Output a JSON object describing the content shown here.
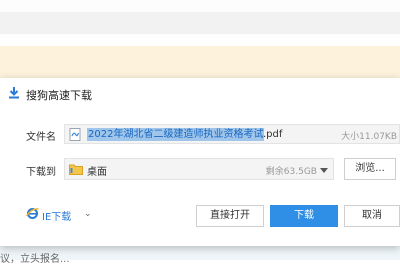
{
  "background": {
    "bottom_text": "议，立头报名..."
  },
  "dialog": {
    "title": "搜狗高速下载",
    "filename_label": "文件名",
    "filename_selected": "2022年湖北省二级建造师执业资格考试",
    "filename_ext": ".pdf",
    "file_size": "大小11.07KB",
    "download_to_label": "下载到",
    "destination": "桌面",
    "free_space": "剩余63.5GB",
    "browse_label": "浏览...",
    "ie_download_label": "IE下载",
    "open_direct_label": "直接打开",
    "download_label": "下载",
    "cancel_label": "取消"
  },
  "colors": {
    "accent": "#2f8fe6",
    "selection": "#9fc6ea",
    "yellow_bar": "#fdf3dd"
  },
  "icons": {
    "title": "download-arrow-icon",
    "file": "pdf-file-icon",
    "folder": "folder-icon",
    "ie": "ie-logo-icon",
    "chevron": "chevron-down-icon"
  }
}
